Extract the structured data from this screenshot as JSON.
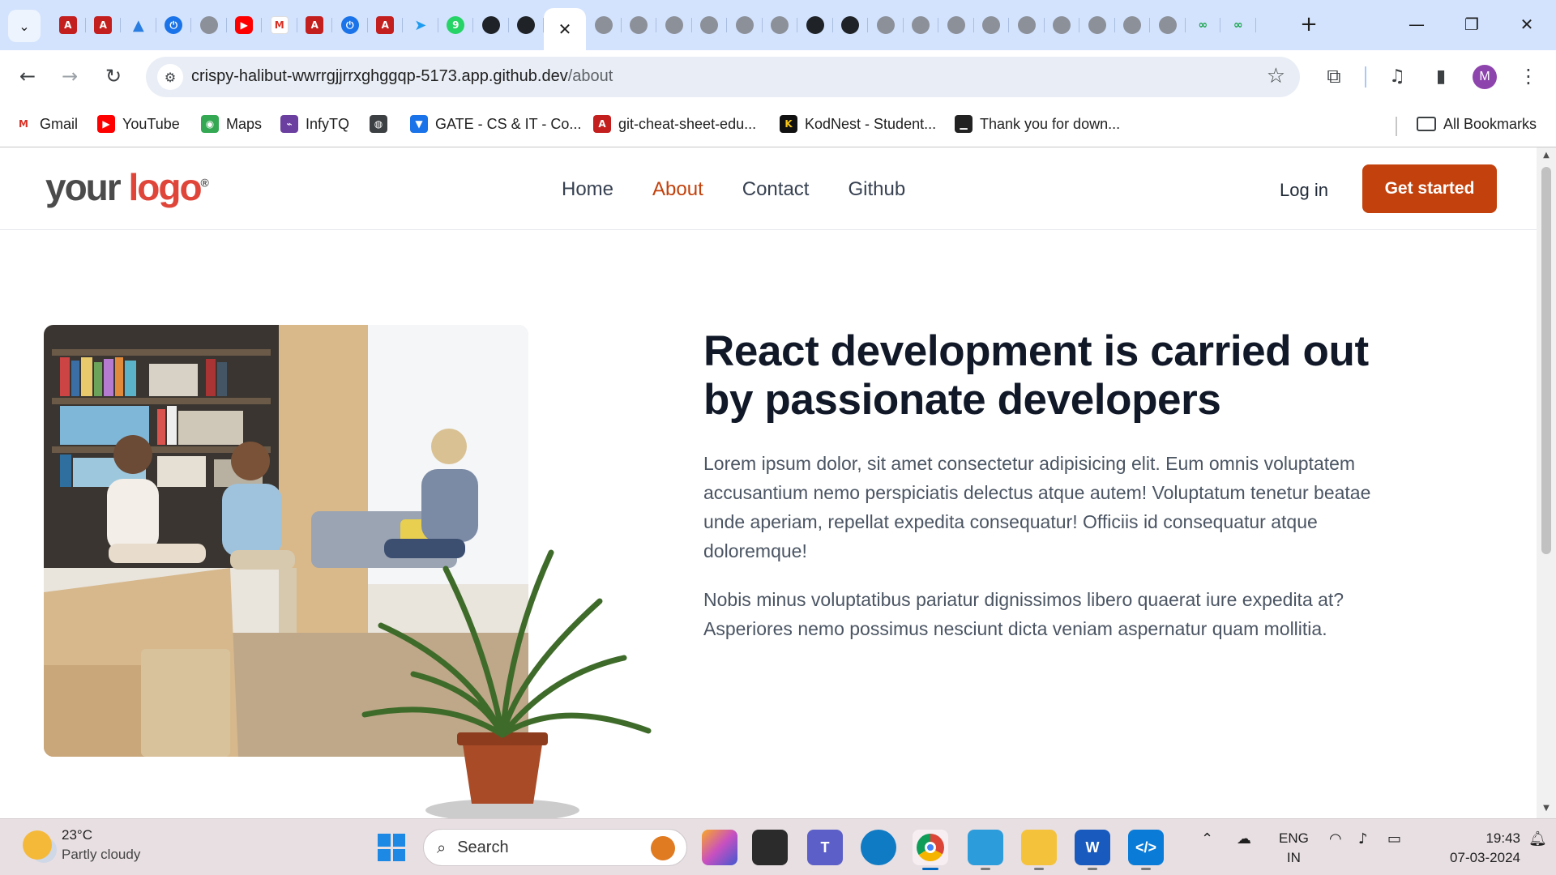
{
  "browser": {
    "tabs": [
      {
        "icon": "chevron-down-icon"
      },
      {
        "icon": "pdf-icon"
      },
      {
        "icon": "pdf-icon"
      },
      {
        "icon": "azure-icon"
      },
      {
        "icon": "power-icon"
      },
      {
        "icon": "globe-icon"
      },
      {
        "icon": "youtube-icon"
      },
      {
        "icon": "gmail-icon"
      },
      {
        "icon": "pdf-icon"
      },
      {
        "icon": "power-icon"
      },
      {
        "icon": "pdf-icon"
      },
      {
        "icon": "bird-icon"
      },
      {
        "icon": "whatsapp-icon"
      },
      {
        "icon": "github-icon"
      },
      {
        "icon": "github-icon"
      },
      {
        "icon": "close-icon",
        "active": true
      },
      {
        "icon": "globe-icon"
      },
      {
        "icon": "globe-icon"
      },
      {
        "icon": "globe-icon"
      },
      {
        "icon": "globe-icon"
      },
      {
        "icon": "globe-icon"
      },
      {
        "icon": "globe-icon"
      },
      {
        "icon": "github-icon"
      },
      {
        "icon": "github-icon"
      },
      {
        "icon": "globe-icon"
      },
      {
        "icon": "globe-icon"
      },
      {
        "icon": "globe-icon"
      },
      {
        "icon": "globe-icon"
      },
      {
        "icon": "globe-icon"
      },
      {
        "icon": "globe-icon"
      },
      {
        "icon": "globe-icon"
      },
      {
        "icon": "globe-icon"
      },
      {
        "icon": "globe-icon"
      },
      {
        "icon": "infinity-icon"
      },
      {
        "icon": "infinity-icon"
      }
    ],
    "url_host": "crispy-halibut-wwrrgjjrrxghggqp-5173.app.github.dev",
    "url_path": "/about",
    "profile_initial": "M",
    "bookmarks": [
      {
        "label": "Gmail",
        "icon": "gmail-icon"
      },
      {
        "label": "YouTube",
        "icon": "youtube-icon"
      },
      {
        "label": "Maps",
        "icon": "maps-icon"
      },
      {
        "label": "InfyTQ",
        "icon": "infytq-icon"
      },
      {
        "label": "",
        "icon": "globe-icon"
      },
      {
        "label": "GATE - CS & IT - Co...",
        "icon": "gate-icon"
      },
      {
        "label": "git-cheat-sheet-edu...",
        "icon": "pdf-icon"
      },
      {
        "label": "KodNest - Student...",
        "icon": "kodnest-icon"
      },
      {
        "label": "Thank you for down...",
        "icon": "download-icon"
      }
    ],
    "all_bookmarks": "All Bookmarks"
  },
  "site": {
    "logo_part1": "your",
    "logo_part2": "logo",
    "logo_mark": "®",
    "nav": [
      {
        "label": "Home",
        "active": false
      },
      {
        "label": "About",
        "active": true
      },
      {
        "label": "Contact",
        "active": false
      },
      {
        "label": "Github",
        "active": false
      }
    ],
    "login": "Log in",
    "cta": "Get started",
    "accent": "#c2410c",
    "headline": "React development is carried out by passionate developers",
    "paragraph1": "Lorem ipsum dolor, sit amet consectetur adipisicing elit. Eum omnis voluptatem accusantium nemo perspiciatis delectus atque autem! Voluptatum tenetur beatae unde aperiam, repellat expedita consequatur! Officiis id consequatur atque doloremque!",
    "paragraph2": "Nobis minus voluptatibus pariatur dignissimos libero quaerat iure expedita at? Asperiores nemo possimus nesciunt dicta veniam aspernatur quam mollitia."
  },
  "taskbar": {
    "temperature": "23°C",
    "weather": "Partly cloudy",
    "search_placeholder": "Search",
    "lang1": "ENG",
    "lang2": "IN",
    "time": "19:43",
    "date": "07-03-2024"
  }
}
